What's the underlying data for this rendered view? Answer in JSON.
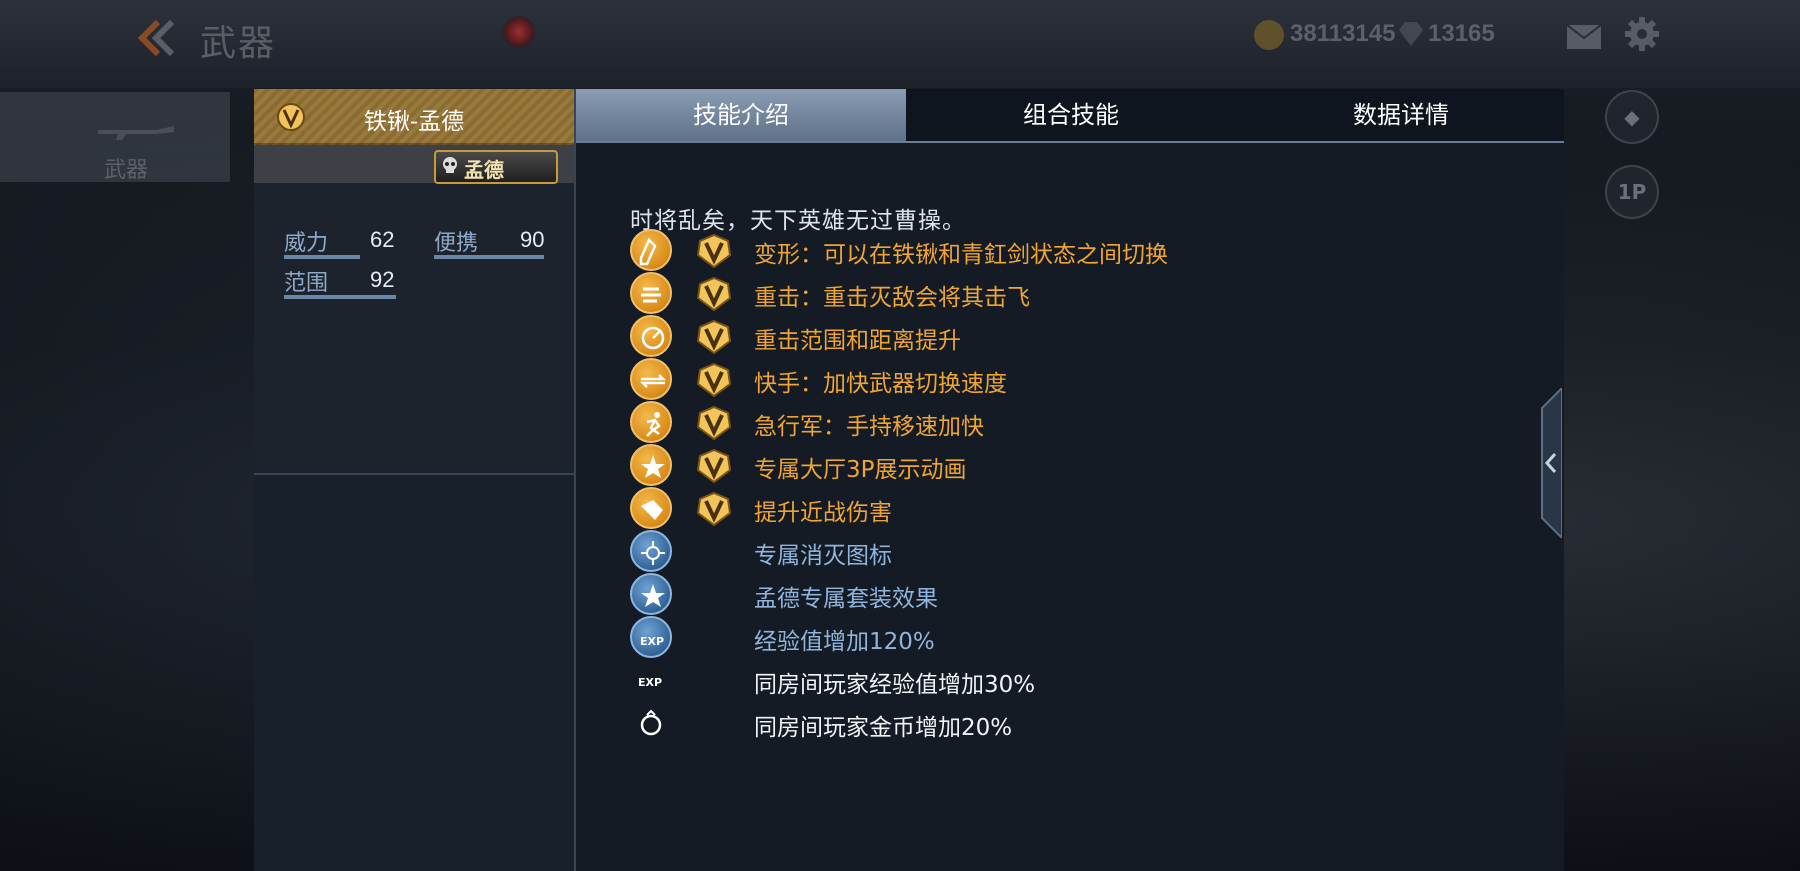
{
  "topbar": {
    "title": "武器",
    "gold_amount": "38113145",
    "gem_amount": "13165"
  },
  "left_rail": {
    "weapons_label": "武器"
  },
  "right_rail": {
    "view_1p_label": "1P"
  },
  "weapon": {
    "name": "铁锹-孟德",
    "skin_badge": "孟德",
    "stats": [
      {
        "label": "威力",
        "value": "62",
        "level": 0.62
      },
      {
        "label": "便携",
        "value": "90",
        "level": 0.9
      },
      {
        "label": "范围",
        "value": "92",
        "level": 0.92
      }
    ]
  },
  "tabs": [
    "技能介绍",
    "组合技能",
    "数据详情"
  ],
  "active_tab": 0,
  "description": "时将乱矣，天下英雄无过曹操。",
  "skills": [
    {
      "text": "变形：可以在铁锹和青釭剑状态之间切换",
      "tier": "gold",
      "icon": "transform-icon",
      "vip": true
    },
    {
      "text": "重击：重击灭敌会将其击飞",
      "tier": "gold",
      "icon": "heavy-strike-icon",
      "vip": true
    },
    {
      "text": "重击范围和距离提升",
      "tier": "gold",
      "icon": "range-icon",
      "vip": true
    },
    {
      "text": "快手：加快武器切换速度",
      "tier": "gold",
      "icon": "quick-swap-icon",
      "vip": true
    },
    {
      "text": "急行军：手持移速加快",
      "tier": "gold",
      "icon": "running-icon",
      "vip": true
    },
    {
      "text": "专属大厅3P展示动画",
      "tier": "gold",
      "icon": "star-icon",
      "vip": true
    },
    {
      "text": "提升近战伤害",
      "tier": "gold",
      "icon": "melee-damage-icon",
      "vip": true
    },
    {
      "text": "专属消灭图标",
      "tier": "blue",
      "icon": "kill-icon",
      "vip": false
    },
    {
      "text": "孟德专属套装效果",
      "tier": "blue",
      "icon": "star-icon",
      "vip": false
    },
    {
      "text": "经验值增加120%",
      "tier": "blue",
      "icon": "exp-icon",
      "vip": false
    },
    {
      "text": "同房间玩家经验值增加30%",
      "tier": "white",
      "icon": "room-exp-icon",
      "vip": false
    },
    {
      "text": "同房间玩家金币增加20%",
      "tier": "white",
      "icon": "room-coin-icon",
      "vip": false
    }
  ],
  "colors": {
    "gold": "#f0a532",
    "blue": "#8fb5dd",
    "active_tab": "#7a8da4"
  }
}
